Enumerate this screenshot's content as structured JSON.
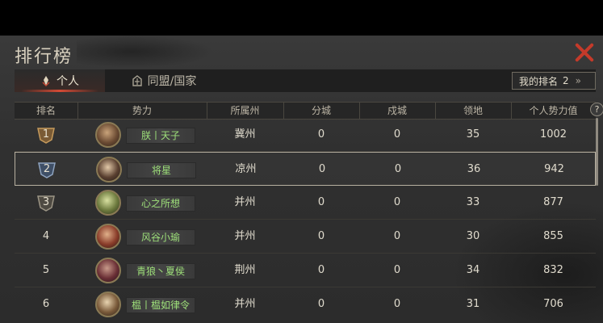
{
  "window": {
    "title": "排行榜"
  },
  "tabs": [
    {
      "label": "个人",
      "active": true
    },
    {
      "label": "同盟/国家",
      "active": false
    }
  ],
  "my_rank": {
    "label": "我的排名",
    "value": "2",
    "arrow": "»"
  },
  "columns": [
    "排名",
    "势力",
    "所属州",
    "分城",
    "戍城",
    "领地",
    "个人势力值"
  ],
  "help_label": "?",
  "rows": [
    {
      "rank": "1",
      "name": "朕丨天子",
      "state": "冀州",
      "branch": "0",
      "garrison": "0",
      "territory": "35",
      "power": "1002",
      "badge": "gold"
    },
    {
      "rank": "2",
      "name": "将星",
      "state": "凉州",
      "branch": "0",
      "garrison": "0",
      "territory": "36",
      "power": "942",
      "badge": "silver",
      "selected": true
    },
    {
      "rank": "3",
      "name": "心之所想",
      "state": "并州",
      "branch": "0",
      "garrison": "0",
      "territory": "33",
      "power": "877",
      "badge": "bronze"
    },
    {
      "rank": "4",
      "name": "风谷小瑜",
      "state": "并州",
      "branch": "0",
      "garrison": "0",
      "territory": "30",
      "power": "855"
    },
    {
      "rank": "5",
      "name": "青狼丶夏侯",
      "state": "荆州",
      "branch": "0",
      "garrison": "0",
      "territory": "34",
      "power": "832"
    },
    {
      "rank": "6",
      "name": "榅丨榅如律令",
      "state": "并州",
      "branch": "0",
      "garrison": "0",
      "territory": "31",
      "power": "706"
    }
  ],
  "colors": {
    "accent_red": "#c43a2a",
    "name_green": "#9ee07a"
  }
}
